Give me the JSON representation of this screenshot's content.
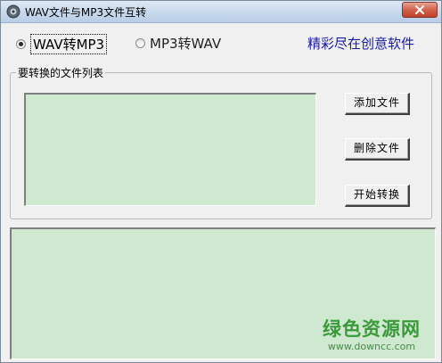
{
  "window": {
    "title": "WAV文件与MP3文件互转"
  },
  "mode": {
    "options": [
      {
        "label": "WAV转MP3",
        "selected": true
      },
      {
        "label": "MP3转WAV",
        "selected": false
      }
    ]
  },
  "slogan": "精彩尽在创意软件",
  "file_group": {
    "legend": "要转换的文件列表"
  },
  "buttons": {
    "add": "添加文件",
    "delete": "删除文件",
    "start": "开始转换"
  },
  "watermark": {
    "main": "绿色资源网",
    "url": "www.downcc.com"
  },
  "colors": {
    "list_bg": "#cfe8d0",
    "slogan": "#1a1aa6",
    "watermark": "#3a9a3a"
  }
}
